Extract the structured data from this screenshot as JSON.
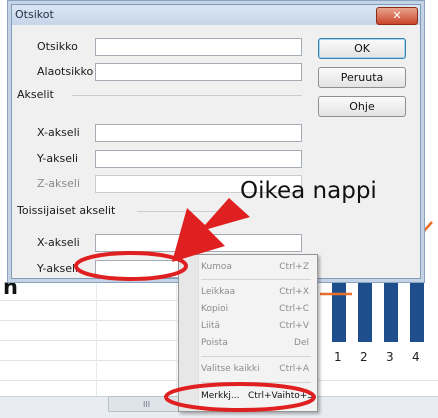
{
  "dialog": {
    "title": "Otsikot",
    "fields": {
      "title_label": "Otsikko",
      "subtitle_label": "Alaotsikko",
      "title_value": "",
      "subtitle_value": ""
    },
    "axes_section": "Akselit",
    "axes": {
      "x_label": "X-akseli",
      "y_label": "Y-akseli",
      "z_label": "Z-akseli"
    },
    "secondary_section": "Toissijaiset akselit",
    "secondary": {
      "x_label": "X-akseli",
      "y_label": "Y-akseli"
    },
    "buttons": {
      "ok": "OK",
      "cancel": "Peruuta",
      "help": "Ohje"
    }
  },
  "context_menu": {
    "items": [
      {
        "label": "Kumoa",
        "shortcut": "Ctrl+Z"
      },
      {
        "label": "Leikkaa",
        "shortcut": "Ctrl+X"
      },
      {
        "label": "Kopioi",
        "shortcut": "Ctrl+C"
      },
      {
        "label": "Liitä",
        "shortcut": "Ctrl+V"
      },
      {
        "label": "Poista",
        "shortcut": "Del"
      },
      {
        "label": "Valitse kaikki",
        "shortcut": "Ctrl+A"
      },
      {
        "label": "Merkkj...",
        "shortcut": "Ctrl+Vaihto+S"
      }
    ]
  },
  "annotation": {
    "callout": "Oikea nappi"
  },
  "background": {
    "partial_label": "n",
    "close_icon": "close-icon",
    "scroll_grip": "III"
  },
  "chart_data": {
    "type": "bar",
    "categories": [
      "1",
      "2",
      "3",
      "4"
    ],
    "values": [
      78,
      80,
      80,
      82
    ],
    "ylim": [
      0,
      100
    ],
    "bar_color": "#1f4e8c",
    "line_color": "#e8702a"
  }
}
